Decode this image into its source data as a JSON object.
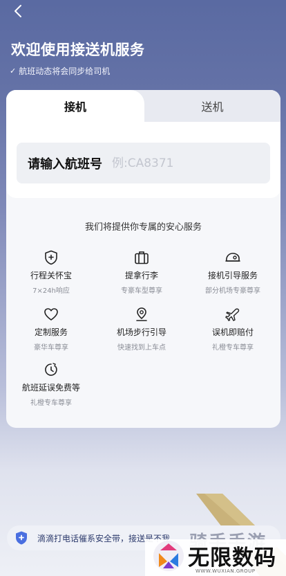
{
  "header": {
    "title": "欢迎使用接送机服务",
    "subtitle": "航班动态将会同步给司机",
    "check_icon": "✓"
  },
  "tabs": [
    {
      "label": "接机",
      "active": true
    },
    {
      "label": "送机",
      "active": false
    }
  ],
  "flight_input": {
    "label": "请输入航班号",
    "placeholder": "例:CA8371",
    "value": ""
  },
  "services": {
    "title": "我们将提供你专属的安心服务",
    "items": [
      {
        "name": "行程关怀宝",
        "desc": "7×24h响应",
        "icon": "shield-plus-icon"
      },
      {
        "name": "提拿行李",
        "desc": "专豪车型尊享",
        "icon": "luggage-icon"
      },
      {
        "name": "接机引导服务",
        "desc": "部分机场专豪尊享",
        "icon": "cap-icon"
      },
      {
        "name": "定制服务",
        "desc": "豪华车尊享",
        "icon": "heart-icon"
      },
      {
        "name": "机场步行引导",
        "desc": "快速找到上车点",
        "icon": "location-pin-icon"
      },
      {
        "name": "误机即赔付",
        "desc": "礼橙专车尊享",
        "icon": "plane-icon"
      },
      {
        "name": "航班延误免费等",
        "desc": "礼橙专车尊享",
        "icon": "timer-icon"
      }
    ]
  },
  "bottom_bar": {
    "text": "滴滴打电话催系安全带，接送是不我"
  },
  "watermark": {
    "main": "无限数码",
    "faint": "骑手手游",
    "sub": "WWW.WUXIAN.GROUP"
  },
  "colors": {
    "header_bg": "#5a6aa2",
    "accent": "#2c3a6c",
    "wing_gold": "#c9b27a"
  }
}
